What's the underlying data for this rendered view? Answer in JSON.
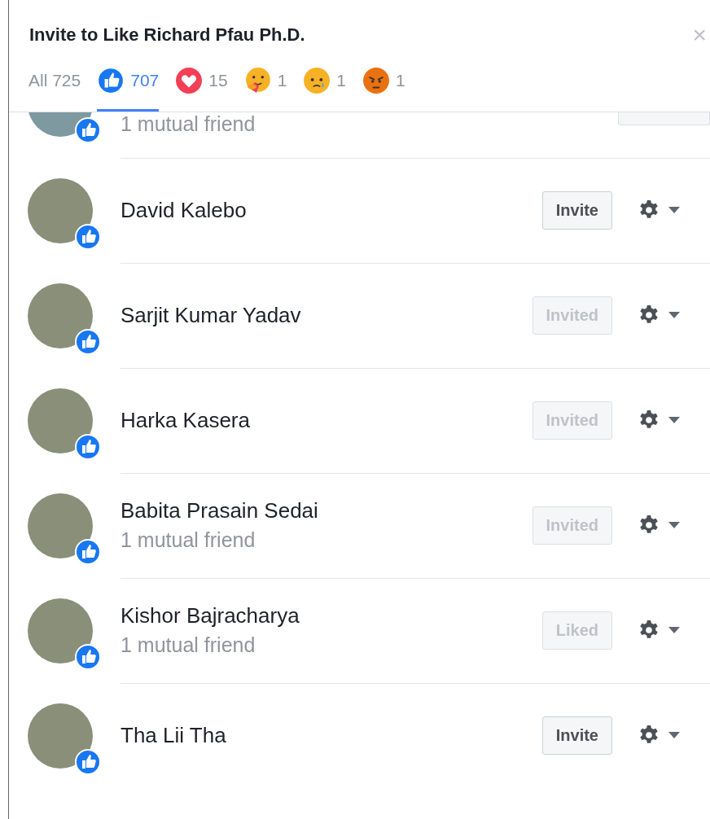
{
  "dialog": {
    "title": "Invite to Like Richard Pfau Ph.D.",
    "close": "×"
  },
  "tabs": [
    {
      "kind": "all",
      "label": "All 725",
      "selected": false
    },
    {
      "kind": "like",
      "label": "707",
      "selected": true
    },
    {
      "kind": "love",
      "label": "15",
      "selected": false
    },
    {
      "kind": "care",
      "label": "1",
      "selected": false
    },
    {
      "kind": "sad",
      "label": "1",
      "selected": false
    },
    {
      "kind": "angry",
      "label": "1",
      "selected": false
    }
  ],
  "people": [
    {
      "partial": true,
      "subtitle": "1 mutual friend",
      "button": {
        "disabled": true
      }
    },
    {
      "name": "David Kalebo",
      "button": {
        "label": "Invite",
        "disabled": false
      }
    },
    {
      "name": "Sarjit Kumar Yadav",
      "button": {
        "label": "Invited",
        "disabled": true
      }
    },
    {
      "name": "Harka Kasera",
      "button": {
        "label": "Invited",
        "disabled": true
      }
    },
    {
      "name": "Babita Prasain Sedai",
      "subtitle": "1 mutual friend",
      "button": {
        "label": "Invited",
        "disabled": true
      }
    },
    {
      "name": "Kishor Bajracharya",
      "subtitle": "1 mutual friend",
      "button": {
        "label": "Liked",
        "disabled": true
      }
    },
    {
      "name": "Tha Lii Tha",
      "button": {
        "label": "Invite",
        "disabled": false
      }
    }
  ]
}
